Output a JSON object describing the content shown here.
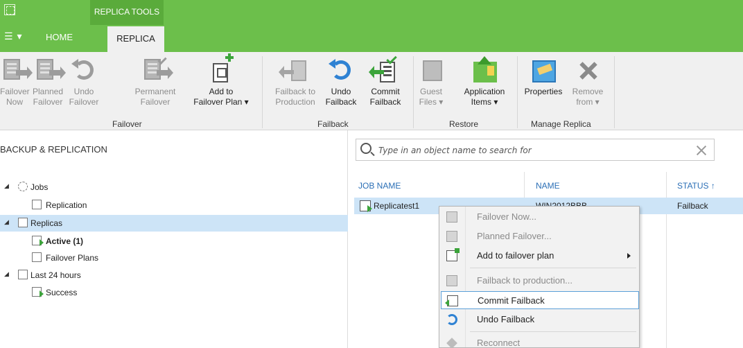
{
  "window": {
    "tools_header": "REPLICA TOOLS",
    "menu_button": "☰ ▾",
    "tabs": [
      {
        "label": "HOME",
        "active": false
      },
      {
        "label": "REPLICA",
        "active": true
      }
    ]
  },
  "ribbon": {
    "groups": [
      {
        "label": "Failover"
      },
      {
        "label": "Failback"
      },
      {
        "label": "Restore"
      },
      {
        "label": "Manage Replica"
      }
    ],
    "buttons": {
      "failover_now": [
        "Failover",
        "Now"
      ],
      "planned_failover": [
        "Planned",
        "Failover"
      ],
      "undo_failover": [
        "Undo",
        "Failover"
      ],
      "permanent_failover": [
        "Permanent",
        "Failover"
      ],
      "add_to_failover_plan": [
        "Add to",
        "Failover Plan ▾"
      ],
      "failback_to_production": [
        "Failback to",
        "Production"
      ],
      "undo_failback": [
        "Undo",
        "Failback"
      ],
      "commit_failback": [
        "Commit",
        "Failback"
      ],
      "guest_files": [
        "Guest",
        "Files ▾"
      ],
      "application_items": [
        "Application",
        "Items ▾"
      ],
      "properties": [
        "Properties",
        ""
      ],
      "remove_from": [
        "Remove",
        "from ▾"
      ]
    }
  },
  "left_pane": {
    "header": "BACKUP & REPLICATION",
    "tree": [
      {
        "label": "Jobs",
        "expander": "◢",
        "selected": false,
        "bold": false,
        "icon": "jobs-gear-icon"
      },
      {
        "label": "Replication",
        "expander": "",
        "selected": false,
        "bold": false,
        "icon": "replication-job-icon"
      },
      {
        "label": "Replicas",
        "expander": "◢",
        "selected": true,
        "bold": false,
        "icon": "replicas-icon"
      },
      {
        "label": "Active (1)",
        "expander": "",
        "selected": false,
        "bold": true,
        "icon": "active-replica-icon"
      },
      {
        "label": "Failover Plans",
        "expander": "",
        "selected": false,
        "bold": false,
        "icon": "failover-plan-icon"
      },
      {
        "label": "Last 24 hours",
        "expander": "◢",
        "selected": false,
        "bold": false,
        "icon": "last-24-hours-icon"
      },
      {
        "label": "Success",
        "expander": "",
        "selected": false,
        "bold": false,
        "icon": "success-icon"
      }
    ]
  },
  "right_pane": {
    "search": {
      "placeholder": "Type in an object name to search for",
      "value": ""
    },
    "columns": {
      "job_name": "JOB NAME",
      "name": "NAME",
      "status": "STATUS ↑"
    },
    "rows": [
      {
        "job_name": "Replicatest1",
        "name": "WIN2012BBB",
        "status": "Failback"
      }
    ]
  },
  "context_menu": {
    "items": [
      {
        "label": "Failover Now...",
        "enabled": false,
        "icon": "failover-now-icon"
      },
      {
        "label": "Planned Failover...",
        "enabled": false,
        "icon": "planned-failover-icon"
      },
      {
        "label": "Add to failover plan",
        "enabled": true,
        "icon": "add-to-plan-icon",
        "submenu": true
      },
      {
        "label": "Failback to production...",
        "enabled": false,
        "icon": "failback-icon"
      },
      {
        "label": "Commit Failback",
        "enabled": true,
        "icon": "commit-failback-icon",
        "highlighted": true
      },
      {
        "label": "Undo Failback",
        "enabled": true,
        "icon": "undo-failback-icon"
      },
      {
        "label": "Reconnect",
        "enabled": false,
        "icon": "reconnect-icon"
      }
    ]
  },
  "colors": {
    "accent_green": "#6cbf4b",
    "selection_blue": "#cde4f7",
    "header_blue": "#2b6fb6"
  }
}
